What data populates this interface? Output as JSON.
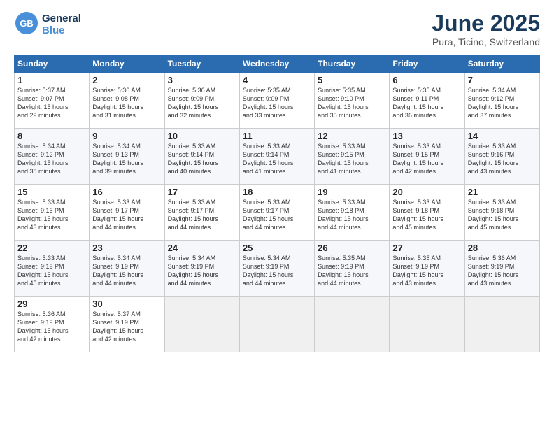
{
  "header": {
    "logo_general": "General",
    "logo_blue": "Blue",
    "month_title": "June 2025",
    "location": "Pura, Ticino, Switzerland"
  },
  "weekdays": [
    "Sunday",
    "Monday",
    "Tuesday",
    "Wednesday",
    "Thursday",
    "Friday",
    "Saturday"
  ],
  "days": [
    {
      "num": "",
      "detail": ""
    },
    {
      "num": "",
      "detail": ""
    },
    {
      "num": "",
      "detail": ""
    },
    {
      "num": "",
      "detail": ""
    },
    {
      "num": "",
      "detail": ""
    },
    {
      "num": "",
      "detail": ""
    },
    {
      "num": "",
      "detail": ""
    },
    {
      "num": "1",
      "detail": "Sunrise: 5:37 AM\nSunset: 9:07 PM\nDaylight: 15 hours\nand 29 minutes."
    },
    {
      "num": "2",
      "detail": "Sunrise: 5:36 AM\nSunset: 9:08 PM\nDaylight: 15 hours\nand 31 minutes."
    },
    {
      "num": "3",
      "detail": "Sunrise: 5:36 AM\nSunset: 9:09 PM\nDaylight: 15 hours\nand 32 minutes."
    },
    {
      "num": "4",
      "detail": "Sunrise: 5:35 AM\nSunset: 9:09 PM\nDaylight: 15 hours\nand 33 minutes."
    },
    {
      "num": "5",
      "detail": "Sunrise: 5:35 AM\nSunset: 9:10 PM\nDaylight: 15 hours\nand 35 minutes."
    },
    {
      "num": "6",
      "detail": "Sunrise: 5:35 AM\nSunset: 9:11 PM\nDaylight: 15 hours\nand 36 minutes."
    },
    {
      "num": "7",
      "detail": "Sunrise: 5:34 AM\nSunset: 9:12 PM\nDaylight: 15 hours\nand 37 minutes."
    },
    {
      "num": "8",
      "detail": "Sunrise: 5:34 AM\nSunset: 9:12 PM\nDaylight: 15 hours\nand 38 minutes."
    },
    {
      "num": "9",
      "detail": "Sunrise: 5:34 AM\nSunset: 9:13 PM\nDaylight: 15 hours\nand 39 minutes."
    },
    {
      "num": "10",
      "detail": "Sunrise: 5:33 AM\nSunset: 9:14 PM\nDaylight: 15 hours\nand 40 minutes."
    },
    {
      "num": "11",
      "detail": "Sunrise: 5:33 AM\nSunset: 9:14 PM\nDaylight: 15 hours\nand 41 minutes."
    },
    {
      "num": "12",
      "detail": "Sunrise: 5:33 AM\nSunset: 9:15 PM\nDaylight: 15 hours\nand 41 minutes."
    },
    {
      "num": "13",
      "detail": "Sunrise: 5:33 AM\nSunset: 9:15 PM\nDaylight: 15 hours\nand 42 minutes."
    },
    {
      "num": "14",
      "detail": "Sunrise: 5:33 AM\nSunset: 9:16 PM\nDaylight: 15 hours\nand 43 minutes."
    },
    {
      "num": "15",
      "detail": "Sunrise: 5:33 AM\nSunset: 9:16 PM\nDaylight: 15 hours\nand 43 minutes."
    },
    {
      "num": "16",
      "detail": "Sunrise: 5:33 AM\nSunset: 9:17 PM\nDaylight: 15 hours\nand 44 minutes."
    },
    {
      "num": "17",
      "detail": "Sunrise: 5:33 AM\nSunset: 9:17 PM\nDaylight: 15 hours\nand 44 minutes."
    },
    {
      "num": "18",
      "detail": "Sunrise: 5:33 AM\nSunset: 9:17 PM\nDaylight: 15 hours\nand 44 minutes."
    },
    {
      "num": "19",
      "detail": "Sunrise: 5:33 AM\nSunset: 9:18 PM\nDaylight: 15 hours\nand 44 minutes."
    },
    {
      "num": "20",
      "detail": "Sunrise: 5:33 AM\nSunset: 9:18 PM\nDaylight: 15 hours\nand 45 minutes."
    },
    {
      "num": "21",
      "detail": "Sunrise: 5:33 AM\nSunset: 9:18 PM\nDaylight: 15 hours\nand 45 minutes."
    },
    {
      "num": "22",
      "detail": "Sunrise: 5:33 AM\nSunset: 9:19 PM\nDaylight: 15 hours\nand 45 minutes."
    },
    {
      "num": "23",
      "detail": "Sunrise: 5:34 AM\nSunset: 9:19 PM\nDaylight: 15 hours\nand 44 minutes."
    },
    {
      "num": "24",
      "detail": "Sunrise: 5:34 AM\nSunset: 9:19 PM\nDaylight: 15 hours\nand 44 minutes."
    },
    {
      "num": "25",
      "detail": "Sunrise: 5:34 AM\nSunset: 9:19 PM\nDaylight: 15 hours\nand 44 minutes."
    },
    {
      "num": "26",
      "detail": "Sunrise: 5:35 AM\nSunset: 9:19 PM\nDaylight: 15 hours\nand 44 minutes."
    },
    {
      "num": "27",
      "detail": "Sunrise: 5:35 AM\nSunset: 9:19 PM\nDaylight: 15 hours\nand 43 minutes."
    },
    {
      "num": "28",
      "detail": "Sunrise: 5:36 AM\nSunset: 9:19 PM\nDaylight: 15 hours\nand 43 minutes."
    },
    {
      "num": "29",
      "detail": "Sunrise: 5:36 AM\nSunset: 9:19 PM\nDaylight: 15 hours\nand 42 minutes."
    },
    {
      "num": "30",
      "detail": "Sunrise: 5:37 AM\nSunset: 9:19 PM\nDaylight: 15 hours\nand 42 minutes."
    },
    {
      "num": "",
      "detail": ""
    },
    {
      "num": "",
      "detail": ""
    },
    {
      "num": "",
      "detail": ""
    },
    {
      "num": "",
      "detail": ""
    },
    {
      "num": "",
      "detail": ""
    }
  ]
}
